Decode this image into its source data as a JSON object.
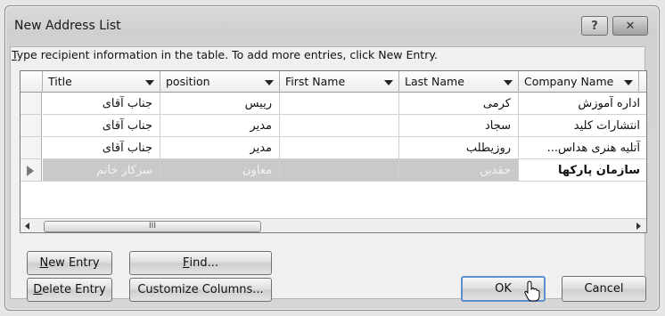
{
  "dialog": {
    "title": "New Address List",
    "help_label": "?",
    "close_label": "✕"
  },
  "instructions": {
    "first_char": "T",
    "rest": "ype recipient information in the table.  To add more entries, click New Entry."
  },
  "table": {
    "columns": [
      {
        "label": "Title"
      },
      {
        "label": "position"
      },
      {
        "label": "First Name"
      },
      {
        "label": "Last Name"
      },
      {
        "label": "Company Name"
      }
    ],
    "rows": [
      {
        "title": "جناب آقای",
        "position": "رییس",
        "first_name": "",
        "last_name": "کرمی",
        "company": "اداره آموزش"
      },
      {
        "title": "جناب آقای",
        "position": "مدیر",
        "first_name": "",
        "last_name": "سجاد",
        "company": "انتشارات کلید"
      },
      {
        "title": "جناب آقای",
        "position": "مدیر",
        "first_name": "",
        "last_name": "روزیطلب",
        "company": "آتلیه هنری هداس..."
      },
      {
        "title": "سرکار خانم",
        "position": "معاون",
        "first_name": "",
        "last_name": "حقدین",
        "company": "سازمان پارکها"
      }
    ],
    "scroll_thumb": "III"
  },
  "buttons": {
    "new_entry": {
      "key": "N",
      "rest": "ew Entry"
    },
    "find": {
      "key": "F",
      "rest": "ind..."
    },
    "delete_entry": {
      "key": "D",
      "rest": "elete Entry"
    },
    "customize_columns": {
      "key": "",
      "label": "Customize Columns..."
    },
    "ok": "OK",
    "cancel": "Cancel"
  }
}
